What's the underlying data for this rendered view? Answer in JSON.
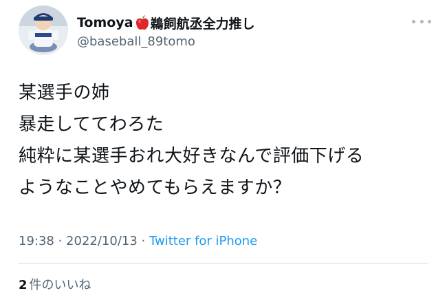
{
  "author": {
    "display_name": "Tomoya",
    "name_emoji": "apple-emoji",
    "name_suffix": "鵜飼航丞全力推し",
    "handle": "@baseball_89tomo"
  },
  "tweet": {
    "lines": [
      "某選手の姉",
      "暴走しててわろた",
      "純粋に某選手おれ大好きなんで評価下げる",
      "ようなことやめてもらえますか？"
    ],
    "time": "19:38",
    "separator1": " · ",
    "date": "2022/10/13",
    "separator2": " · ",
    "source": "Twitter for iPhone"
  },
  "engagement": {
    "likes_count": "2",
    "likes_label": "件のいいね"
  },
  "icons": {
    "more": "more-options-icon",
    "avatar": "avatar-image"
  },
  "colors": {
    "text": "#0f1419",
    "muted": "#536471",
    "link": "#1d9bf0",
    "divider": "#cfd9de"
  }
}
